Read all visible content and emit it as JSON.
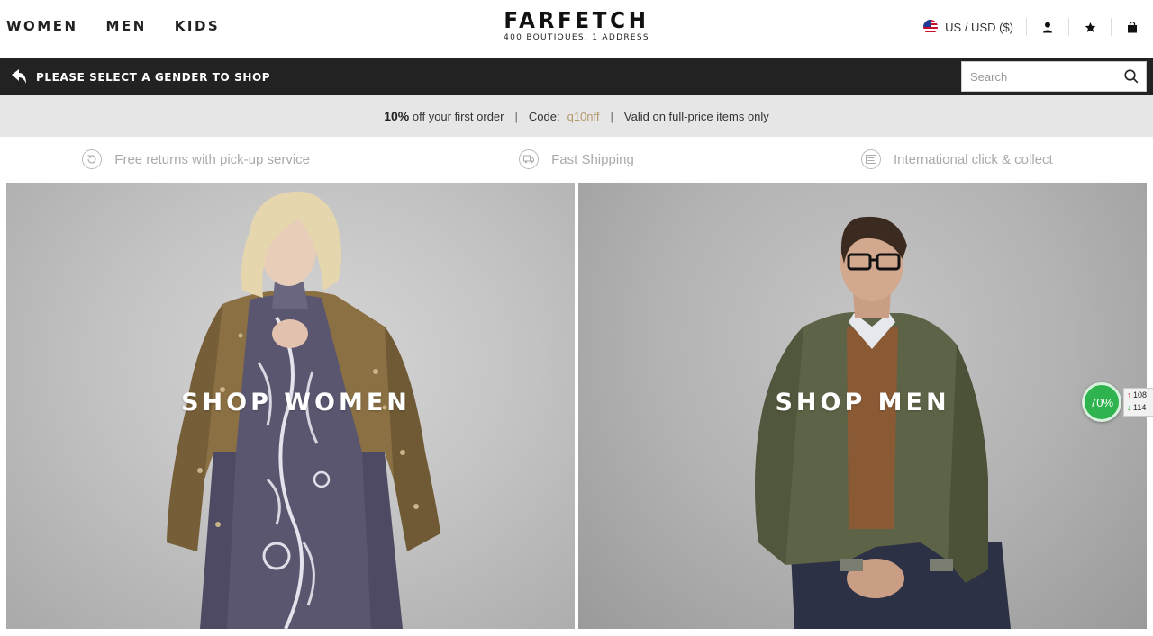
{
  "header": {
    "nav": [
      "WOMEN",
      "MEN",
      "KIDS"
    ],
    "logo": {
      "name": "FARFETCH",
      "tagline": "400 BOUTIQUES. 1 ADDRESS"
    },
    "locale": "US / USD ($)",
    "icons": [
      "user-icon",
      "star-icon",
      "shopping-bag-icon"
    ]
  },
  "subbar": {
    "prompt": "PLEASE SELECT A GENDER TO SHOP",
    "search_placeholder": "Search"
  },
  "promo": {
    "discount": "10%",
    "discount_text": "off your first order",
    "separator": "|",
    "code_label": "Code:",
    "code": "q10nff",
    "valid_text": "Valid on full-price items only",
    "accent_color": "#b49a6b"
  },
  "benefits": [
    {
      "label": "Free returns with pick-up service",
      "icon": "returns-icon"
    },
    {
      "label": "Fast Shipping",
      "icon": "shipping-icon"
    },
    {
      "label": "International click & collect",
      "icon": "click-collect-icon"
    }
  ],
  "hero": {
    "women_label": "SHOP WOMEN",
    "men_label": "SHOP MEN"
  },
  "widget": {
    "percent": "70%",
    "stat_up": "108",
    "stat_down": "114",
    "color": "#2eb34f"
  }
}
